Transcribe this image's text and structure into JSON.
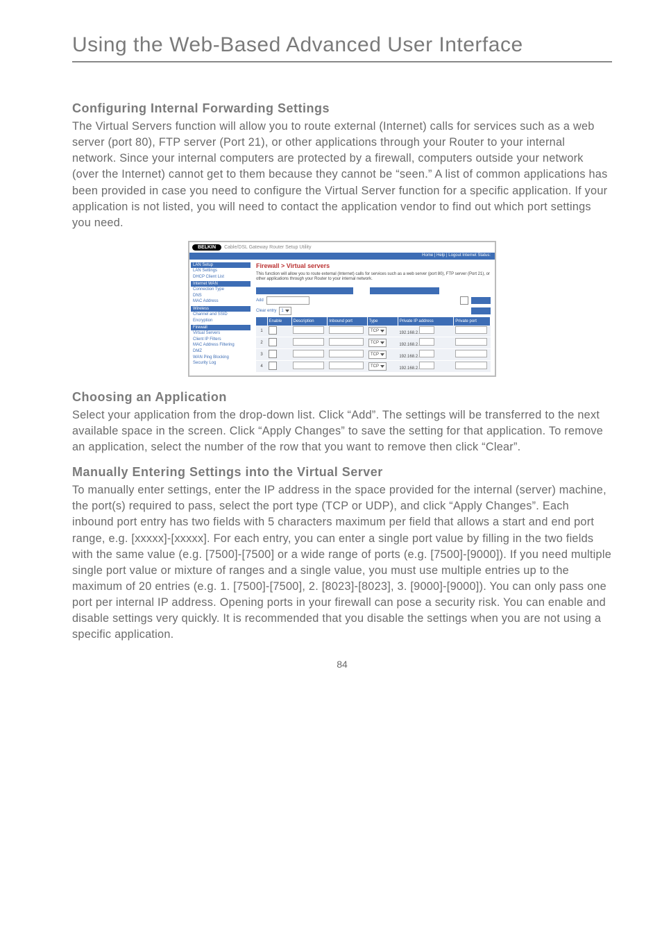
{
  "pageTitle": "Using the Web-Based Advanced User Interface",
  "section1": {
    "heading": "Configuring Internal Forwarding Settings",
    "body": "The Virtual Servers function will allow you to route external (Internet) calls for services such as a web server (port 80), FTP server (Port 21), or other applications through your Router to your internal network. Since your internal computers are protected by a firewall, computers outside your network (over the Internet) cannot get to them because they cannot be “seen.” A list of common applications has been provided in case you need to configure the Virtual Server function for a specific application. If your application is not listed, you will need to contact the application vendor to find out which port settings you need."
  },
  "section2": {
    "heading": "Choosing an Application",
    "body": "Select your application from the drop-down list. Click “Add”. The settings will be transferred to the next available space in the screen. Click “Apply Changes” to save the setting for that application. To remove an application, select the number of the row that you want to remove then click “Clear”."
  },
  "section3": {
    "heading": "Manually Entering Settings into the Virtual Server",
    "body": "To manually enter settings, enter the IP address in the space provided for the internal (server) machine, the port(s) required to pass, select the port type (TCP or UDP), and click “Apply Changes”. Each inbound port entry has two fields with 5 characters maximum per field that allows a start and end port range, e.g. [xxxxx]-[xxxxx]. For each entry, you can enter a single port value by filling in the two fields with the same value (e.g. [7500]-[7500] or a wide range of ports (e.g. [7500]-[9000]). If you need multiple single port value or mixture of ranges and a single value, you must use multiple entries up to the maximum of 20 entries (e.g. 1. [7500]-[7500], 2. [8023]-[8023], 3. [9000]-[9000]). You can only pass one port per internal IP address. Opening ports in your firewall can pose a security risk. You can enable and disable settings very quickly. It is recommended that you disable the settings when you are not using a specific application."
  },
  "screenshot": {
    "brand": "BELKIN",
    "tagline": "Cable/DSL Gateway Router Setup Utility",
    "topbarText": "Home | Help | Logout     Internet Status:",
    "panelTitle": "Firewall > Virtual servers",
    "panelDesc": "This function will allow you to route external (Internet) calls for services such as a web server (port 80), FTP server (Port 21), or other applications through your Router to your internal network.",
    "addLabel": "Add",
    "clearLabel": "Clear entry",
    "sidebar": {
      "groups": [
        {
          "head": "LAN Setup",
          "items": [
            "LAN Settings",
            "DHCP Client List"
          ]
        },
        {
          "head": "Internet WAN",
          "items": [
            "Connection Type",
            "DNS",
            "MAC Address"
          ]
        },
        {
          "head": "Wireless",
          "items": [
            "Channel and SSID",
            "Encryption"
          ]
        },
        {
          "head": "Firewall",
          "items": [
            "Virtual Servers",
            "Client IP Filters",
            "MAC Address Filtering",
            "DMZ",
            "WAN Ping Blocking",
            "Security Log"
          ]
        }
      ]
    },
    "table": {
      "headers": [
        "",
        "Enable",
        "Description",
        "Inbound port",
        "Type",
        "Private IP address",
        "Private port"
      ],
      "typeLabel": "TCP",
      "ipPrefix": "192.168.2.",
      "rowCount": 4
    }
  },
  "pageNumber": "84"
}
